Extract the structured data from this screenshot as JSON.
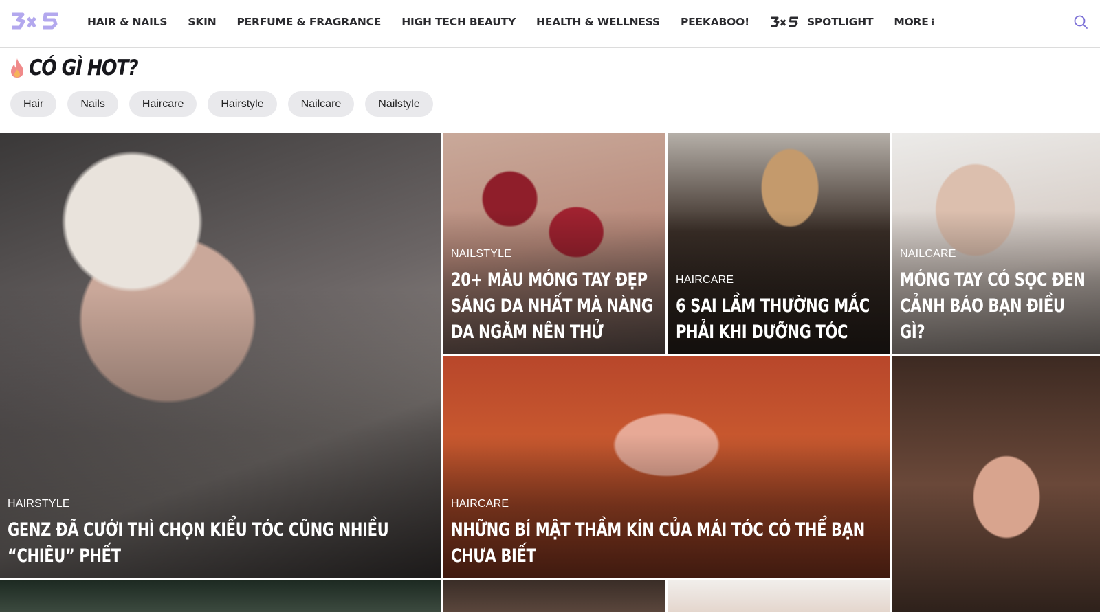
{
  "brand": {
    "logo_text": "3x5"
  },
  "nav": {
    "items": [
      {
        "label": "HAIR & NAILS"
      },
      {
        "label": "SKIN"
      },
      {
        "label": "PERFUME & FRAGRANCE"
      },
      {
        "label": "HIGH TECH BEAUTY"
      },
      {
        "label": "HEALTH & WELLNESS"
      },
      {
        "label": "PEEKABOO!"
      },
      {
        "label": "SPOTLIGHT"
      },
      {
        "label": "MORE"
      }
    ],
    "more_dots": "⁝"
  },
  "section": {
    "title": "CÓ GÌ HOT?"
  },
  "chips": [
    "Hair",
    "Nails",
    "Haircare",
    "Hairstyle",
    "Nailcare",
    "Nailstyle"
  ],
  "cards": [
    {
      "category": "HAIRSTYLE",
      "title": "GENZ ĐÃ CƯỚI THÌ CHỌN KIỂU TÓC CŨNG NHIỀU “CHIÊU” PHẾT"
    },
    {
      "category": "NAILSTYLE",
      "title": "20+ MÀU MÓNG TAY ĐẸP SÁNG DA NHẤT MÀ NÀNG DA NGĂM NÊN THỬ"
    },
    {
      "category": "HAIRCARE",
      "title": "6 SAI LẦM THƯỜNG MẮC PHẢI KHI DƯỠNG TÓC"
    },
    {
      "category": "NAILCARE",
      "title": "MÓNG TAY CÓ SỌC ĐEN CẢNH BÁO BẠN ĐIỀU GÌ?"
    },
    {
      "category": "HAIRCARE",
      "title": "NHỮNG BÍ MẬT THẦM KÍN CỦA MÁI TÓC CÓ THỂ BẠN CHƯA BIẾT"
    },
    {
      "category": "",
      "title": ""
    },
    {
      "category": "",
      "title": ""
    },
    {
      "category": "",
      "title": ""
    },
    {
      "category": "",
      "title": ""
    }
  ],
  "colors": {
    "brand": "#a79ae8",
    "chip_bg": "#e9e9ec",
    "fire": "#f08a8a"
  }
}
